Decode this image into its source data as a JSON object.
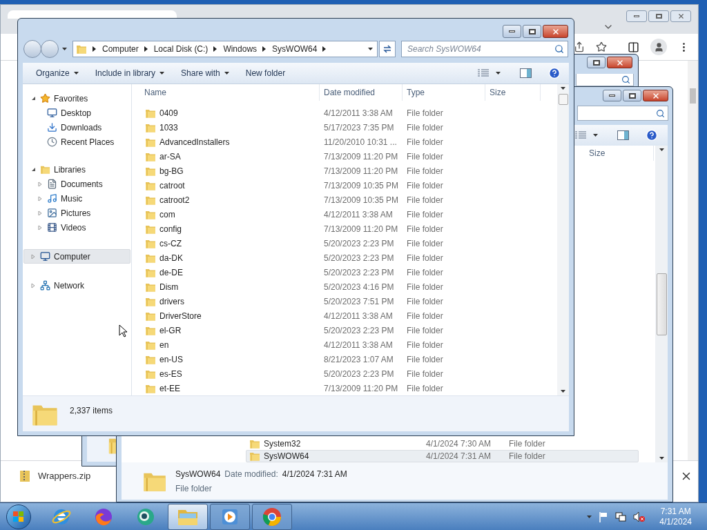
{
  "browser": {
    "download_bar": {
      "file": "Wrappers.zip"
    }
  },
  "window_b": {
    "columns": [
      "Size"
    ],
    "rows": [
      {
        "name": "System32",
        "date": "4/1/2024 7:30 AM",
        "type": "File folder",
        "selected": false
      },
      {
        "name": "SysWOW64",
        "date": "4/1/2024 7:31 AM",
        "type": "File folder",
        "selected": true
      }
    ],
    "details": {
      "name": "SysWOW64",
      "date_label": "Date modified:",
      "date": "4/1/2024 7:31 AM",
      "type": "File folder"
    }
  },
  "explorer": {
    "breadcrumb": [
      "Computer",
      "Local Disk (C:)",
      "Windows",
      "SysWOW64"
    ],
    "search": {
      "placeholder": "Search SysWOW64"
    },
    "toolbar": [
      {
        "label": "Organize",
        "has_menu": true
      },
      {
        "label": "Include in library",
        "has_menu": true
      },
      {
        "label": "Share with",
        "has_menu": true
      },
      {
        "label": "New folder",
        "has_menu": false
      }
    ],
    "nav": [
      {
        "label": "Favorites",
        "kind": "star",
        "expanded": true,
        "highlighted": false,
        "children": [
          {
            "label": "Desktop",
            "kind": "desktop",
            "highlighted": false
          },
          {
            "label": "Downloads",
            "kind": "downloads",
            "highlighted": false
          },
          {
            "label": "Recent Places",
            "kind": "recent",
            "highlighted": false
          }
        ]
      },
      {
        "label": "Libraries",
        "kind": "libraries",
        "expanded": true,
        "highlighted": false,
        "children": [
          {
            "label": "Documents",
            "kind": "documents",
            "expanded": false,
            "highlighted": false
          },
          {
            "label": "Music",
            "kind": "music",
            "expanded": false,
            "highlighted": false
          },
          {
            "label": "Pictures",
            "kind": "pictures",
            "expanded": false,
            "highlighted": false
          },
          {
            "label": "Videos",
            "kind": "videos",
            "expanded": false,
            "highlighted": false
          }
        ]
      },
      {
        "label": "Computer",
        "kind": "computer",
        "expanded": false,
        "highlighted": true
      },
      {
        "label": "Network",
        "kind": "network",
        "expanded": false,
        "highlighted": false
      }
    ],
    "columns": [
      "Name",
      "Date modified",
      "Type",
      "Size"
    ],
    "rows": [
      {
        "name": "0409",
        "date": "4/12/2011 3:38 AM",
        "type": "File folder"
      },
      {
        "name": "1033",
        "date": "5/17/2023 7:35 PM",
        "type": "File folder"
      },
      {
        "name": "AdvancedInstallers",
        "date": "11/20/2010 10:31 ...",
        "type": "File folder"
      },
      {
        "name": "ar-SA",
        "date": "7/13/2009 11:20 PM",
        "type": "File folder"
      },
      {
        "name": "bg-BG",
        "date": "7/13/2009 11:20 PM",
        "type": "File folder"
      },
      {
        "name": "catroot",
        "date": "7/13/2009 10:35 PM",
        "type": "File folder"
      },
      {
        "name": "catroot2",
        "date": "7/13/2009 10:35 PM",
        "type": "File folder"
      },
      {
        "name": "com",
        "date": "4/12/2011 3:38 AM",
        "type": "File folder"
      },
      {
        "name": "config",
        "date": "7/13/2009 11:20 PM",
        "type": "File folder"
      },
      {
        "name": "cs-CZ",
        "date": "5/20/2023 2:23 PM",
        "type": "File folder"
      },
      {
        "name": "da-DK",
        "date": "5/20/2023 2:23 PM",
        "type": "File folder"
      },
      {
        "name": "de-DE",
        "date": "5/20/2023 2:23 PM",
        "type": "File folder"
      },
      {
        "name": "Dism",
        "date": "5/20/2023 4:16 PM",
        "type": "File folder"
      },
      {
        "name": "drivers",
        "date": "5/20/2023 7:51 PM",
        "type": "File folder"
      },
      {
        "name": "DriverStore",
        "date": "4/12/2011 3:38 AM",
        "type": "File folder"
      },
      {
        "name": "el-GR",
        "date": "5/20/2023 2:23 PM",
        "type": "File folder"
      },
      {
        "name": "en",
        "date": "4/12/2011 3:38 AM",
        "type": "File folder"
      },
      {
        "name": "en-US",
        "date": "8/21/2023 1:07 AM",
        "type": "File folder"
      },
      {
        "name": "es-ES",
        "date": "5/20/2023 2:23 PM",
        "type": "File folder"
      },
      {
        "name": "et-EE",
        "date": "7/13/2009 11:20 PM",
        "type": "File folder"
      }
    ],
    "status": {
      "count": "2,337 items"
    }
  },
  "taskbar": {
    "apps": [
      {
        "kind": "ie",
        "running": false,
        "active": false
      },
      {
        "kind": "firefox",
        "running": false,
        "active": false
      },
      {
        "kind": "globe",
        "running": false,
        "active": false
      },
      {
        "kind": "explorer",
        "running": true,
        "active": true
      },
      {
        "kind": "media",
        "running": true,
        "active": false
      },
      {
        "kind": "chrome",
        "running": true,
        "active": false
      }
    ],
    "tray": {
      "volume_muted": true
    },
    "clock": {
      "time": "7:31 AM",
      "date": "4/1/2024"
    }
  }
}
